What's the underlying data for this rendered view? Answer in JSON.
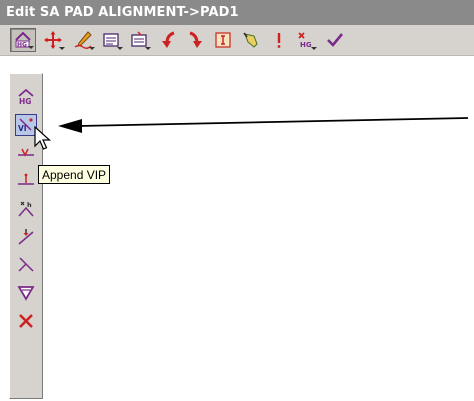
{
  "window": {
    "title": "Edit SA PAD ALIGNMENT->PAD1"
  },
  "toolbar": {
    "buttons": [
      {
        "name": "hg-edit-icon",
        "active": true,
        "has_dropdown": true
      },
      {
        "name": "move-cross-icon",
        "has_dropdown": true
      },
      {
        "name": "pencil-edit-icon",
        "has_dropdown": true
      },
      {
        "name": "text-box-icon",
        "has_dropdown": true
      },
      {
        "name": "text-box-alt-icon",
        "has_dropdown": true
      },
      {
        "name": "undo-arrow-icon"
      },
      {
        "name": "redo-arrow-icon"
      },
      {
        "name": "info-icon"
      },
      {
        "name": "pick-icon"
      },
      {
        "name": "exclamation-icon"
      },
      {
        "name": "delete-hg-icon",
        "has_dropdown": true
      },
      {
        "name": "checkmark-icon"
      }
    ]
  },
  "dropdown": {
    "items": [
      {
        "name": "hg-line-icon"
      },
      {
        "name": "append-vip-icon",
        "hover": true
      },
      {
        "name": "insert-vip-icon"
      },
      {
        "name": "mid-vip-icon"
      },
      {
        "name": "split-h-icon"
      },
      {
        "name": "join-vip-icon"
      },
      {
        "name": "intersect-icon"
      },
      {
        "name": "filter-icon"
      },
      {
        "name": "delete-x-icon"
      }
    ]
  },
  "tooltip": {
    "text": "Append VIP"
  },
  "colors": {
    "titlebar_bg": "#8a8a8a",
    "toolbar_bg": "#d6d3ce",
    "tooltip_bg": "#ffffe1",
    "accent_red": "#cc2222",
    "accent_purple": "#7a2a8a"
  }
}
